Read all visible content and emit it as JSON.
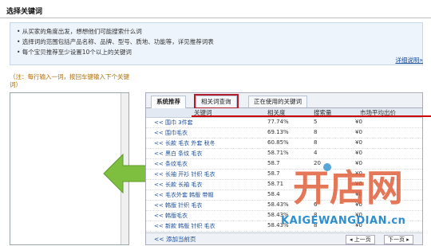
{
  "page": {
    "title": "选择关键词"
  },
  "info": {
    "tips": [
      "• 从买家的角度出发，想想他们可能搜索什么词",
      "• 选择词的范围包括产品名称、品牌、型号、质地、功能等，详见推荐词表",
      "• 每个宝贝推荐至少设置10个以上的关键词"
    ],
    "more_link": "详细说明»"
  },
  "note": "（注：每行输入一词，按回车键输入下个关键词）",
  "tabs": [
    {
      "label": "系统推荐",
      "active": true
    },
    {
      "label": "相关词查询",
      "active": false,
      "highlighted": true
    },
    {
      "label": "正在使用的关键词",
      "active": false
    }
  ],
  "table": {
    "headers": [
      "关键词",
      "相关度",
      "搜索量",
      "市场平均出价"
    ],
    "rows": [
      {
        "keyword": "<< 围巾 3件套",
        "relevance": "77.74%",
        "volume": "5",
        "price": "¥0"
      },
      {
        "keyword": "<< 围巾毛衣",
        "relevance": "69.13%",
        "volume": "8",
        "price": "¥0"
      },
      {
        "keyword": "<< 长款 毛衣 外套 秋冬",
        "relevance": "60.85%",
        "volume": "8",
        "price": "¥0"
      },
      {
        "keyword": "<< 黑白 条纹 毛衣",
        "relevance": "58.71%",
        "volume": "4",
        "price": "¥0"
      },
      {
        "keyword": "<< 条纹毛衣",
        "relevance": "58.7",
        "volume": "20",
        "price": "¥0"
      },
      {
        "keyword": "<< 长袖 开衫 针织 毛衣",
        "relevance": "58.7",
        "volume": "",
        "price": "¥0"
      },
      {
        "keyword": "<< 长款 长袖 毛衣",
        "relevance": "58.71",
        "volume": "",
        "price": "¥0"
      },
      {
        "keyword": "<< 毛衣外套 韩版 带帽",
        "relevance": "58.4",
        "volume": "",
        "price": "¥0"
      },
      {
        "keyword": "<< 韩版 针织 毛衣",
        "relevance": "58.43%",
        "volume": "6",
        "price": "¥0"
      },
      {
        "keyword": "<< 韩版毛衣",
        "relevance": "58.43%",
        "volume": "8",
        "price": "¥0"
      },
      {
        "keyword": "<< 新款 韩版 针织 毛衣",
        "relevance": "58.43%",
        "volume": "8",
        "price": "¥0"
      }
    ]
  },
  "footer": {
    "add_label": "<< 添加当前页",
    "prev_label": "◂ 上一页",
    "next_label": "下一页 ▸"
  },
  "watermark": {
    "url": "KAIGEWANGDIAN.cn"
  },
  "colors": {
    "accent_red": "#b01c2a",
    "arrow_green": "#7fbf3f",
    "link_blue": "#1a4d99"
  }
}
